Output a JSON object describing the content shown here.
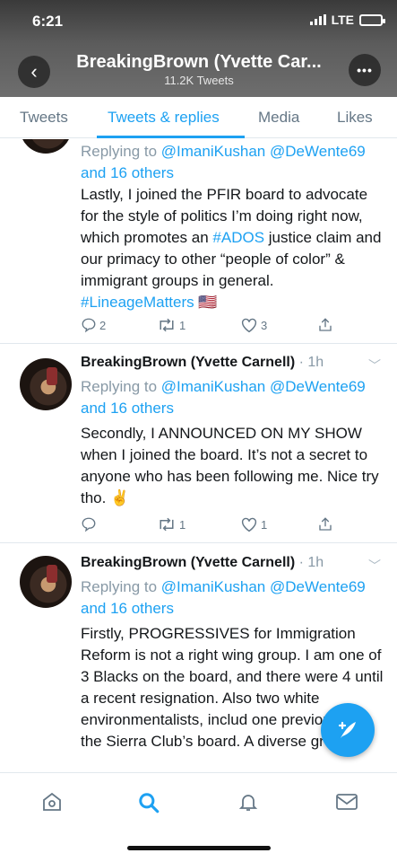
{
  "status": {
    "time": "6:21",
    "network": "LTE"
  },
  "header": {
    "back_icon": "back-arrow-icon",
    "title": "BreakingBrown (Yvette Car...",
    "subtitle": "11.2K Tweets",
    "more_icon": "more-horizontal-icon"
  },
  "tabs": [
    {
      "label": "Tweets"
    },
    {
      "label": "Tweets & replies",
      "active": true
    },
    {
      "label": "Media"
    },
    {
      "label": "Likes"
    }
  ],
  "tweets": [
    {
      "replying_prefix": "Replying to ",
      "mention1": "@ImaniKushan",
      "mention2": "@DeWente69",
      "others": "and 16 others",
      "body_a": "Lastly, I joined the PFIR board to advocate for the style of politics I’m doing right now, which promotes an ",
      "hashtag1": "#ADOS",
      "body_b": " justice claim and our primacy to other “people of color” & immigrant groups in general. ",
      "hashtag2": "#LineageMatters",
      "flag": "🇺🇸",
      "replies": "2",
      "retweets": "1",
      "likes": "3"
    },
    {
      "name": "BreakingBrown (Yvette Carnell)",
      "time": " · 1h",
      "replying_prefix": "Replying to ",
      "mention1": "@ImaniKushan",
      "mention2": "@DeWente69",
      "others": "and 16 others",
      "body": "Secondly, I ANNOUNCED ON MY SHOW when I joined the board. It’s not a secret to anyone who has been following me. Nice try tho. ✌",
      "replies": "",
      "retweets": "1",
      "likes": "1"
    },
    {
      "name": "BreakingBrown (Yvette Carnell)",
      "time": " · 1h",
      "replying_prefix": "Replying to ",
      "mention1": "@ImaniKushan",
      "mention2": "@DeWente69",
      "others": "and 16 others",
      "body": "Firstly, PROGRESSIVES for Immigration Reform is not a right wing group. I am one of 3 Blacks on the board, and there were 4 until a recent resignation. Also two white environmentalists, includ one previously on the Sierra Club’s board. A diverse group."
    }
  ],
  "fab": {
    "icon": "compose-tweet-icon"
  },
  "bottom_nav": [
    "home-icon",
    "search-icon",
    "notifications-bell-icon",
    "messages-envelope-icon"
  ],
  "colors": {
    "accent": "#1da1f2",
    "secondary_text": "#657786",
    "divider": "#e1e8ed"
  }
}
